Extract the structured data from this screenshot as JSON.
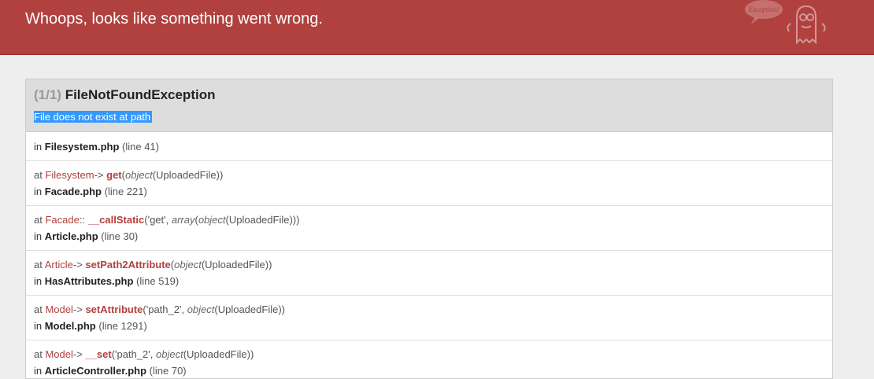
{
  "header": {
    "title": "Whoops, looks like something went wrong.",
    "logo_text": "Exception!",
    "bg_color": "#b0413e"
  },
  "exception": {
    "count": "(1/1)",
    "name": "FileNotFoundException",
    "message": "File does not exist at path"
  },
  "trace": [
    {
      "prefix": "in",
      "file": "Filesystem.php",
      "line": "(line 41)"
    },
    {
      "at": "at",
      "class": "Filesystem",
      "op": "->",
      "method": "get",
      "args_open": "(",
      "arg_type": "object",
      "arg_value": "(UploadedFile)",
      "args_close": ")",
      "prefix": "in",
      "file": "Facade.php",
      "line": "(line 221)"
    },
    {
      "at": "at",
      "class": "Facade",
      "op": "::",
      "method": "__callStatic",
      "args_open": "(",
      "arg_pre": "'get', ",
      "arg_type": "array",
      "arg_type2": "object",
      "arg_value": "(UploadedFile)))",
      "prefix": "in",
      "file": "Article.php",
      "line": "(line 30)"
    },
    {
      "at": "at",
      "class": "Article",
      "op": "->",
      "method": "setPath2Attribute",
      "args_open": "(",
      "arg_type": "object",
      "arg_value": "(UploadedFile))",
      "prefix": "in",
      "file": "HasAttributes.php",
      "line": "(line 519)"
    },
    {
      "at": "at",
      "class": "Model",
      "op": "->",
      "method": "setAttribute",
      "args_open": "(",
      "arg_pre": "'path_2', ",
      "arg_type": "object",
      "arg_value": "(UploadedFile))",
      "prefix": "in",
      "file": "Model.php",
      "line": "(line 1291)"
    },
    {
      "at": "at",
      "class": "Model",
      "op": "->",
      "method": "__set",
      "args_open": "(",
      "arg_pre": "'path_2', ",
      "arg_type": "object",
      "arg_value": "(UploadedFile))",
      "prefix": "in",
      "file": "ArticleController.php",
      "line": "(line 70)"
    }
  ]
}
